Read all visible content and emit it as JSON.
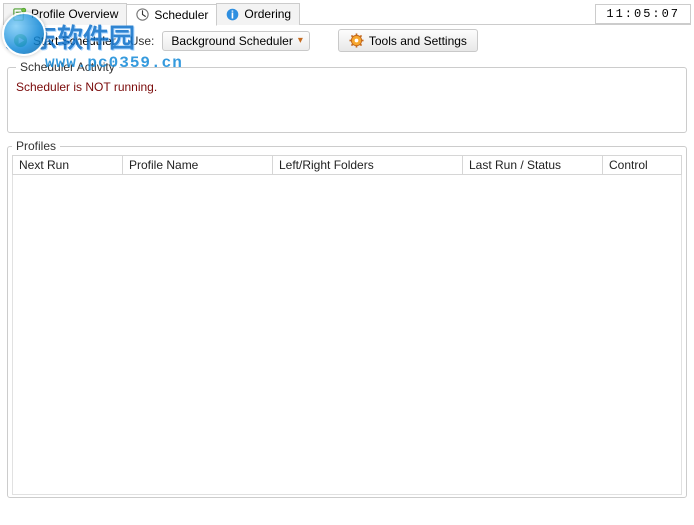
{
  "clock": "11:05:07",
  "tabs": [
    {
      "label": "Profile Overview"
    },
    {
      "label": "Scheduler"
    },
    {
      "label": "Ordering"
    }
  ],
  "toolbar": {
    "start_label": "Start Scheduler",
    "use_label": "Use:",
    "dropdown_selected": "Background Scheduler",
    "tools_label": "Tools and Settings"
  },
  "activity": {
    "legend": "Scheduler Activity",
    "status": "Scheduler is NOT running."
  },
  "profiles": {
    "legend": "Profiles",
    "columns": {
      "next_run": "Next Run",
      "profile_name": "Profile Name",
      "folders": "Left/Right Folders",
      "last_run": "Last Run / Status",
      "control": "Control"
    }
  },
  "watermark": {
    "main": "河东软件园",
    "sub": "www.pc0359.cn"
  }
}
